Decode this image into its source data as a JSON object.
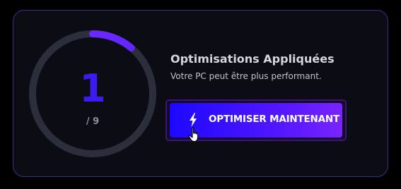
{
  "optimization_card": {
    "title": "Optimisations Appliquées",
    "subtitle": "Votre PC peut être plus performant.",
    "progress": {
      "applied": "1",
      "total_label": "/ 9",
      "applied_value": 1,
      "total_value": 9,
      "fraction": 0.111
    },
    "button": {
      "label": "OPTIMISER MAINTENANT",
      "icon": "lightning-bolt-icon"
    }
  },
  "cursor": {
    "icon": "hand-pointer-cursor-icon"
  },
  "colors": {
    "background": "#000000",
    "card_background": "#0c0d14",
    "card_border": "#3b2f86",
    "ring_track": "#2b2e3b",
    "ring_progress_start": "#5b20ff",
    "ring_progress_end": "#2c0cff",
    "count_text": "#3b1cf0",
    "button_gradient_start": "#1c08ff",
    "button_gradient_end": "#7a24ff"
  }
}
